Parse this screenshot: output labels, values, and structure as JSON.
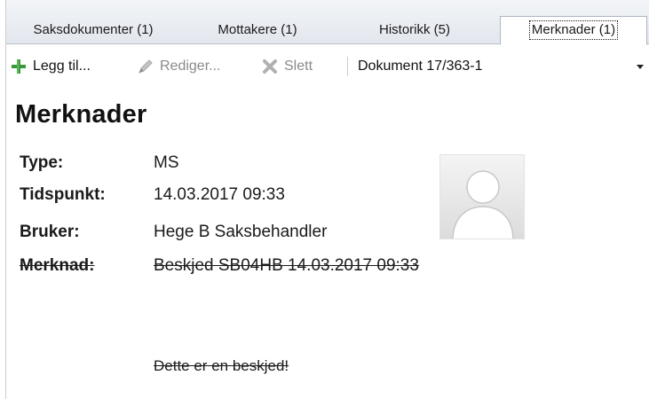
{
  "tabs": [
    {
      "label": "Saksdokumenter (1)"
    },
    {
      "label": "Mottakere (1)"
    },
    {
      "label": "Historikk (5)"
    },
    {
      "label": "Merknader (1)",
      "active": true
    }
  ],
  "toolbar": {
    "add_label": "Legg til...",
    "edit_label": "Rediger...",
    "delete_label": "Slett",
    "document_select": "Dokument 17/363-1",
    "add_icon": "plus-icon",
    "edit_icon": "pencil-icon",
    "delete_icon": "x-icon"
  },
  "note": {
    "heading": "Merknader",
    "type_label": "Type:",
    "type_value": "MS",
    "time_label": "Tidspunkt:",
    "time_value": "14.03.2017 09:33",
    "user_label": "Bruker:",
    "user_value": "Hege B Saksbehandler",
    "note_label": "Merknad:",
    "note_value": "Beskjed SB04HB  14.03.2017 09:33",
    "note_body": "Dette er en beskjed!",
    "avatar_icon": "user-placeholder-icon"
  },
  "colors": {
    "add_icon": "#3a9a3a",
    "disabled_text": "#8a8a8a",
    "tab_background": "#e3e7ee"
  }
}
